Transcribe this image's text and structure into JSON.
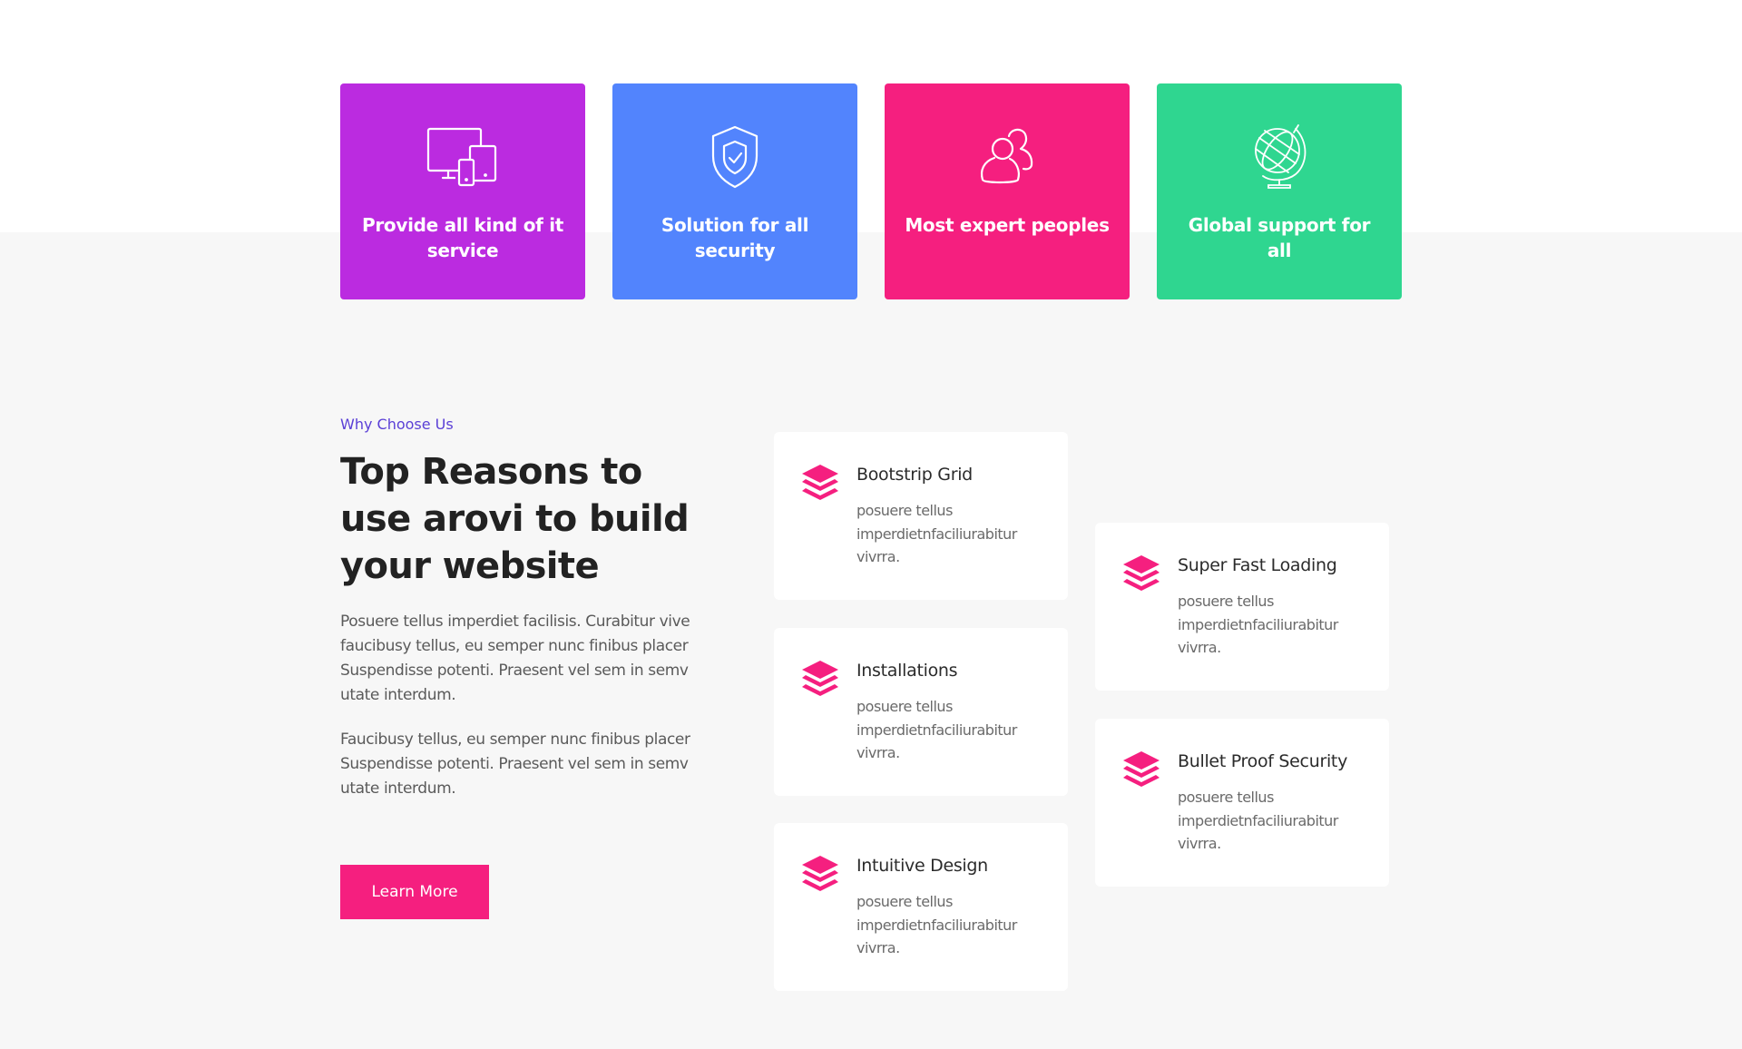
{
  "services": [
    {
      "title": "Provide all kind of it service",
      "icon": "devices-icon",
      "color": "#bb2be0"
    },
    {
      "title": "Solution for all security",
      "icon": "shield-check-icon",
      "color": "#5284fd"
    },
    {
      "title": "Most expert peoples",
      "icon": "users-icon",
      "color": "#f51f7f"
    },
    {
      "title": "Global support for all",
      "icon": "globe-icon",
      "color": "#2fd690"
    }
  ],
  "why": {
    "label": "Why Choose Us",
    "heading": "Top Reasons to use arovi to build your website",
    "paragraph1": "Posuere tellus imperdiet facilisis. Curabitur vive faucibusy tellus, eu semper nunc finibus placer Suspendisse potenti. Praesent vel sem in semv utate interdum.",
    "paragraph2": "Faucibusy tellus, eu semper nunc finibus placer Suspendisse potenti. Praesent vel sem in semv utate interdum.",
    "button_label": "Learn More"
  },
  "features": [
    {
      "title": "Bootstrip Grid",
      "description": "posuere tellus imperdietnfaciliurabitur vivrra."
    },
    {
      "title": "Installations",
      "description": "posuere tellus imperdietnfaciliurabitur vivrra."
    },
    {
      "title": "Intuitive Design",
      "description": "posuere tellus imperdietnfaciliurabitur vivrra."
    },
    {
      "title": "Super Fast Loading",
      "description": "posuere tellus imperdietnfaciliurabitur vivrra."
    },
    {
      "title": "Bullet Proof Security",
      "description": "posuere tellus imperdietnfaciliurabitur vivrra."
    }
  ],
  "colors": {
    "accent": "#f51f7f",
    "label": "#5a3fd6",
    "background": "#f7f7f7"
  }
}
